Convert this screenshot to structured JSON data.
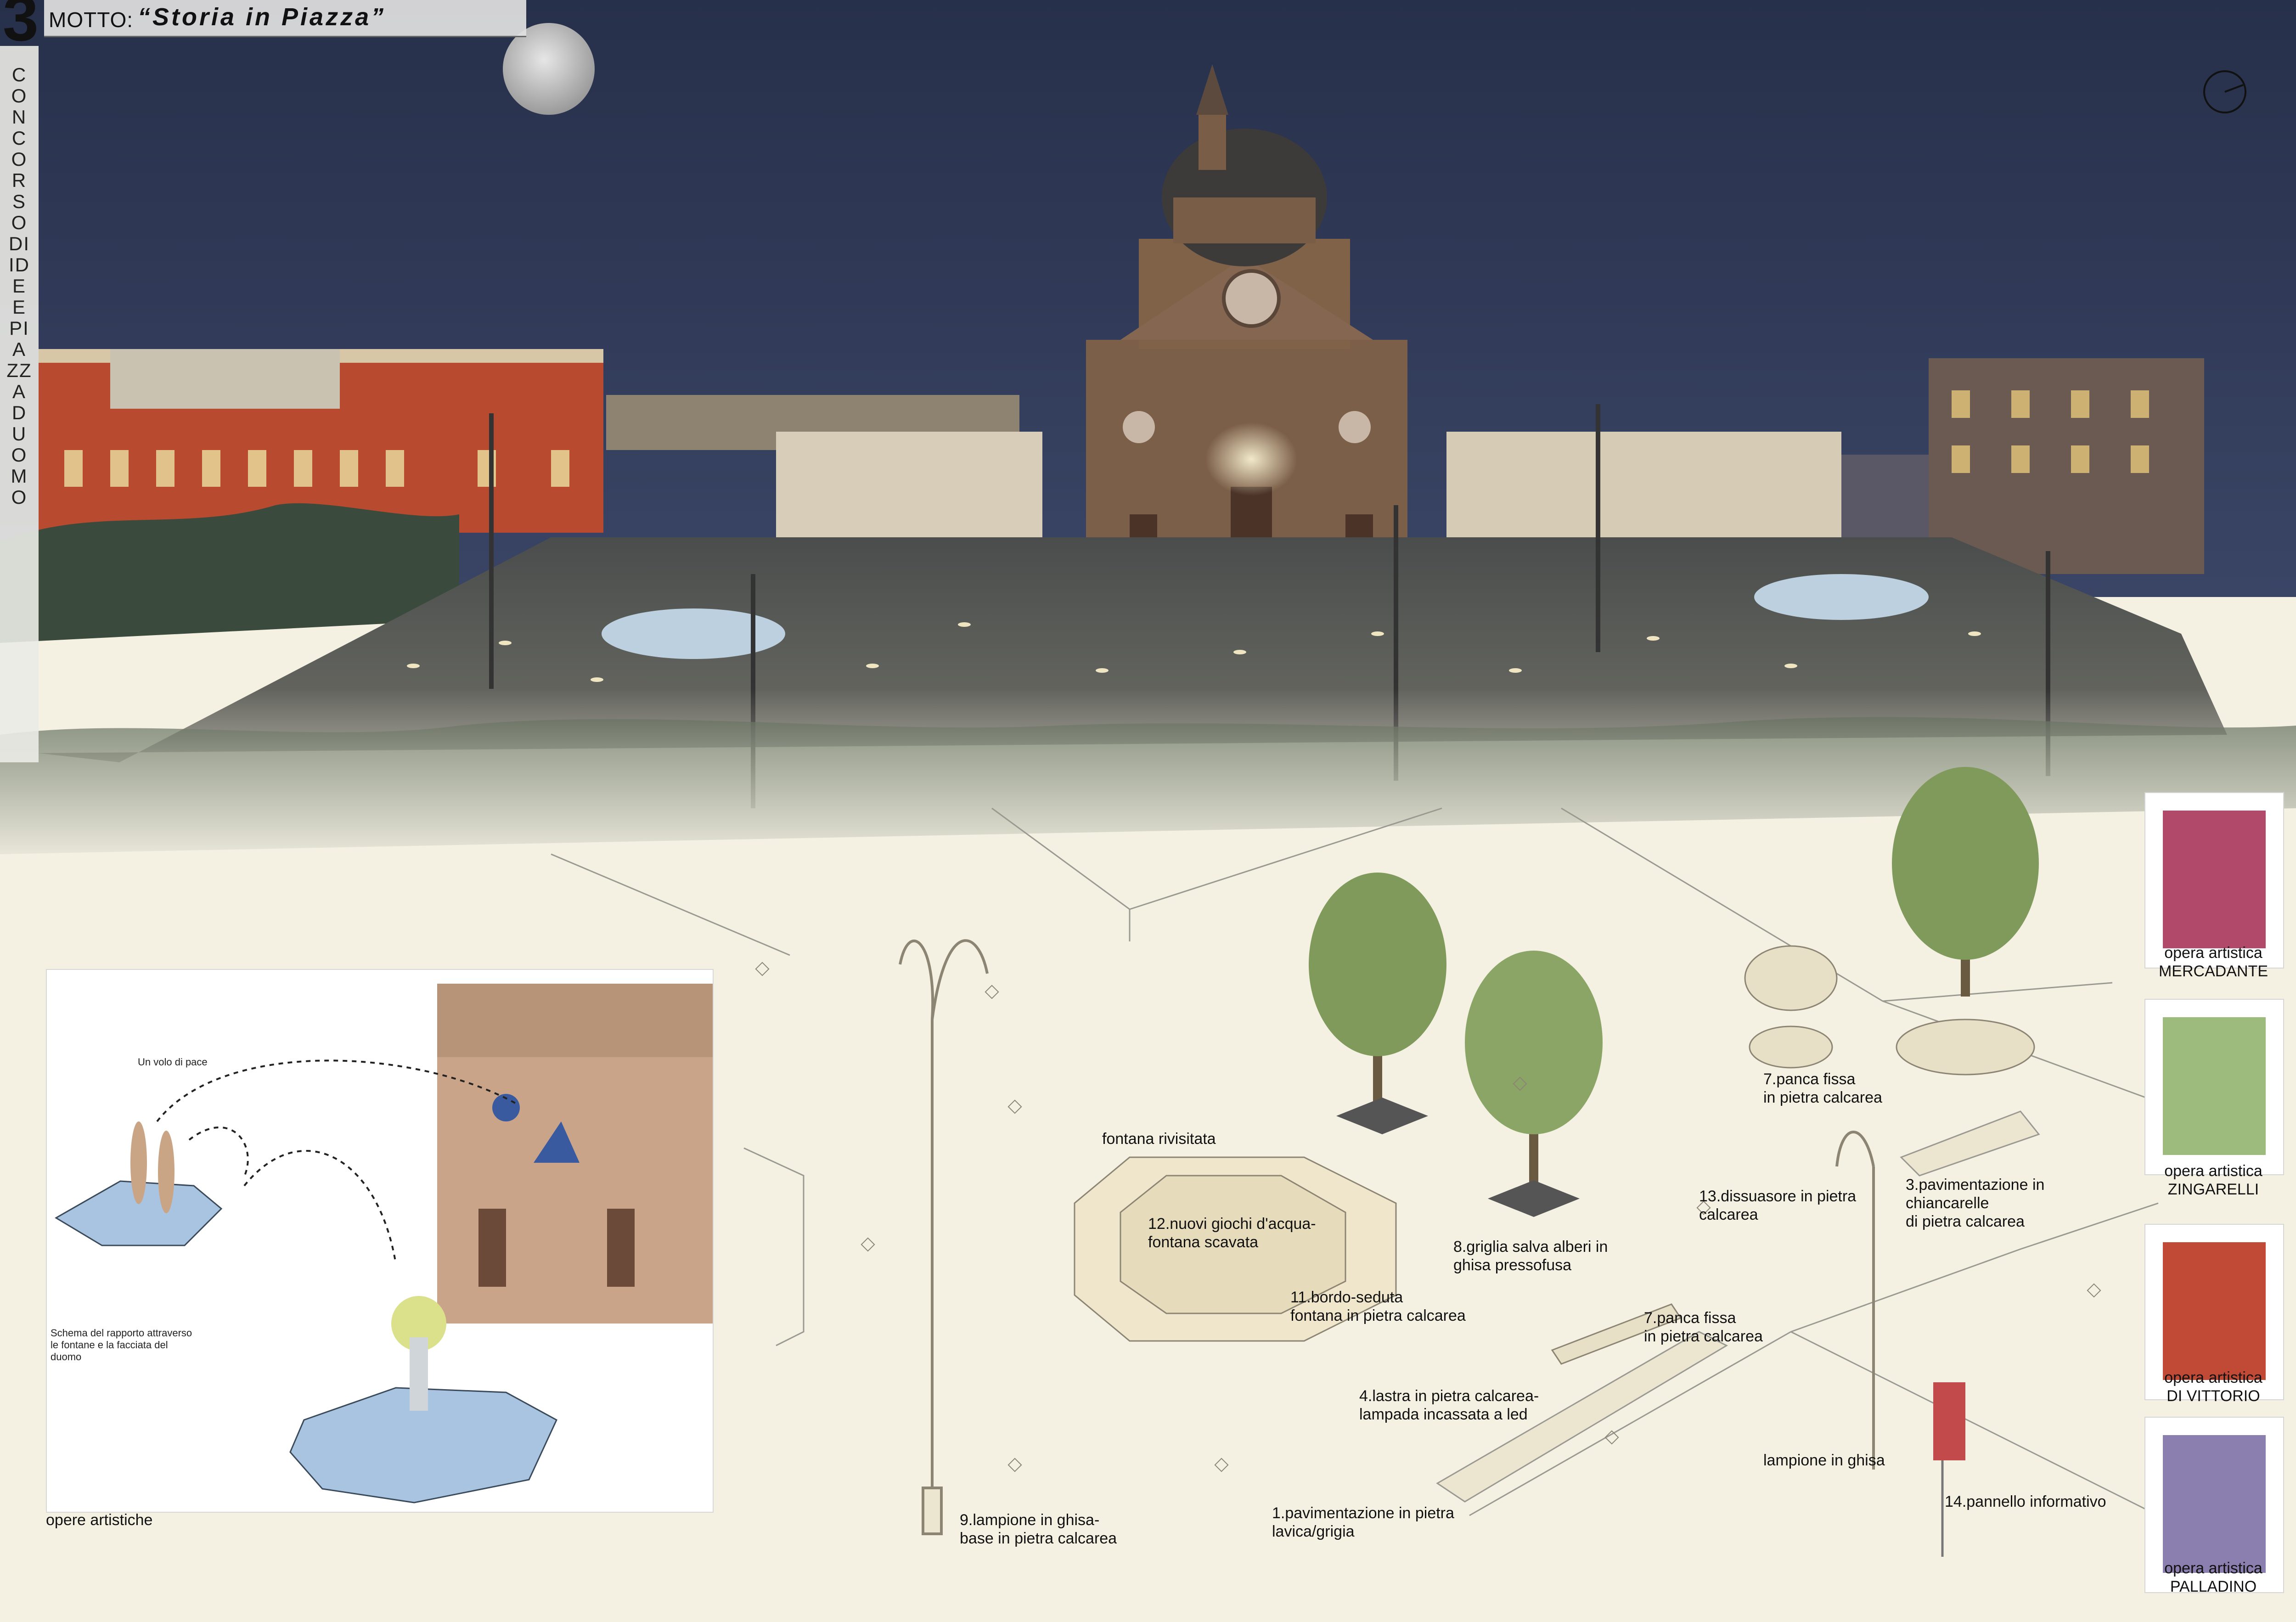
{
  "header": {
    "panel_number": "3",
    "motto_label": "MOTTO:",
    "motto_title": "“Storia in Piazza”",
    "competition_title": "CONCORSO DI IDEE PIAZZA DUOMO"
  },
  "inset": {
    "caption_top": "Un volo di pace",
    "caption_bottom": "Schema del rapporto attraverso le fontane e la facciata del duomo",
    "label": "opere artistiche"
  },
  "plan": {
    "fountain_title": "fontana rivisitata",
    "callouts": {
      "c12": "12.nuovi giochi d'acqua-\nfontana scavata",
      "c11": "11.bordo-seduta\nfontana in pietra calcarea",
      "c8": "8.griglia salva alberi in\nghisa pressofusa",
      "c7a": "7.panca fissa\nin pietra calcarea",
      "c7b": "7.panca fissa\nin pietra calcarea",
      "c13": "13.dissuasore in pietra\ncalcarea",
      "c3": "3.pavimentazione in\nchiancarelle\ndi pietra calcarea",
      "c4": "4.lastra in pietra calcarea-\nlampada incassata a led",
      "c1": "1.pavimentazione in pietra\nlavica/grigia",
      "c9": "9.lampione in ghisa-\nbase in pietra calcarea",
      "clamp": "lampione in ghisa",
      "c14": "14.pannello informativo"
    }
  },
  "artworks": [
    {
      "line1": "opera artistica",
      "line2": "MERCADANTE",
      "color": "#b0496a"
    },
    {
      "line1": "opera artistica",
      "line2": "ZINGARELLI",
      "color": "#9dbb7d"
    },
    {
      "line1": "opera artistica",
      "line2": "DI VITTORIO",
      "color": "#c04a36"
    },
    {
      "line1": "opera artistica",
      "line2": "PALLADINO",
      "color": "#8a7fae"
    }
  ],
  "colors": {
    "sky": "#2b3350",
    "facade": "#8a6a50",
    "paving_plan": "#f4f1e3",
    "water": "#a9c4e0",
    "tree": "#7f9a5a"
  }
}
